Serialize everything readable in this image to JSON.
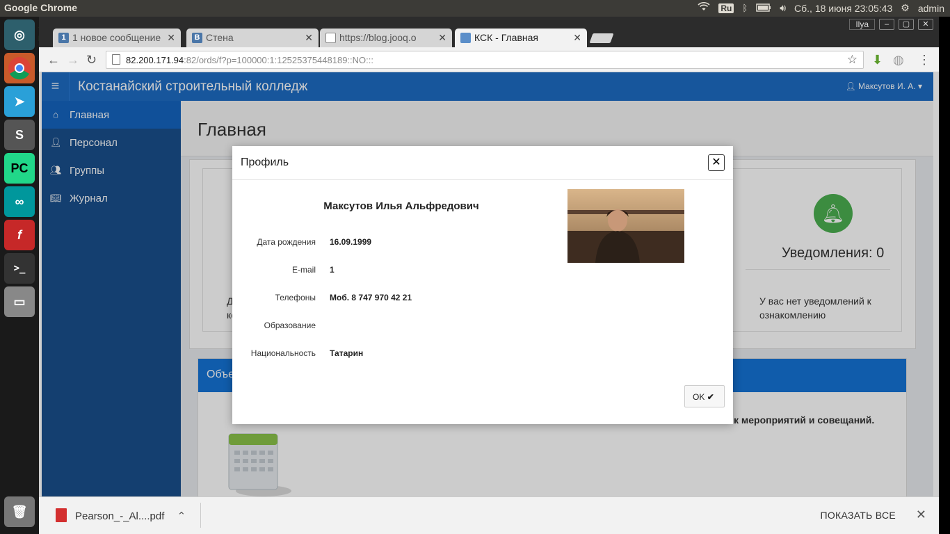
{
  "system": {
    "app_name": "Google Chrome",
    "keyboard_layout": "Ru",
    "datetime": "Сб., 18 июня 23:05:43",
    "username": "admin"
  },
  "launcher": {
    "items": [
      "ubuntu-dash",
      "chrome",
      "telegram",
      "sublime-text",
      "pycharm",
      "arduino",
      "fontforge",
      "terminal",
      "disk",
      "trash"
    ]
  },
  "browser": {
    "profile_user": "Ilya",
    "tabs": [
      {
        "label": "1 новое сообщение",
        "favicon_text": "1",
        "favicon_color": "#4a76a8"
      },
      {
        "label": "Стена",
        "favicon_text": "В",
        "favicon_color": "#4a76a8"
      },
      {
        "label": "https://blog.jooq.o",
        "favicon_text": "",
        "favicon_color": "#888888"
      },
      {
        "label": "КСК - Главная",
        "favicon_text": "",
        "favicon_color": "#5b8ec9"
      }
    ],
    "url_host": "82.200.171.94",
    "url_rest": ":82/ords/f?p=100000:1:12525375448189::NO:::"
  },
  "app": {
    "title": "Костанайский строительный колледж",
    "user_menu": "Максутов И. А.",
    "nav": [
      {
        "label": "Главная",
        "icon": "home-icon"
      },
      {
        "label": "Персонал",
        "icon": "user-icon"
      },
      {
        "label": "Группы",
        "icon": "users-icon"
      },
      {
        "label": "Журнал",
        "icon": "book-icon"
      }
    ],
    "page_title": "Главная",
    "left_card_text_1": "Для",
    "left_card_text_2": "колл",
    "notifications_title": "Уведомления: 0",
    "notifications_text": "У вас нет уведомлений к ознакомлению",
    "region2_title": "Объе",
    "region2_text": "к мероприятий и совещаний."
  },
  "dialog": {
    "title": "Профиль",
    "full_name": "Максутов Илья Альфредович",
    "fields": [
      {
        "label": "Дата рождения",
        "value": "16.09.1999"
      },
      {
        "label": "E-mail",
        "value": "1"
      },
      {
        "label": "Телефоны",
        "value": "Моб. 8 747 970 42 21"
      },
      {
        "label": "Образование",
        "value": ""
      },
      {
        "label": "Национальность",
        "value": "Татарин"
      }
    ],
    "ok_label": "OK"
  },
  "download": {
    "file_name": "Pearson_-_Al....pdf",
    "show_all": "ПОКАЗАТЬ ВСЕ"
  },
  "colors": {
    "header_blue": "#1d6cc4",
    "sidebar_blue": "#1a4f8d",
    "nav_active": "#1565c0",
    "bell_green": "#4caf50"
  }
}
